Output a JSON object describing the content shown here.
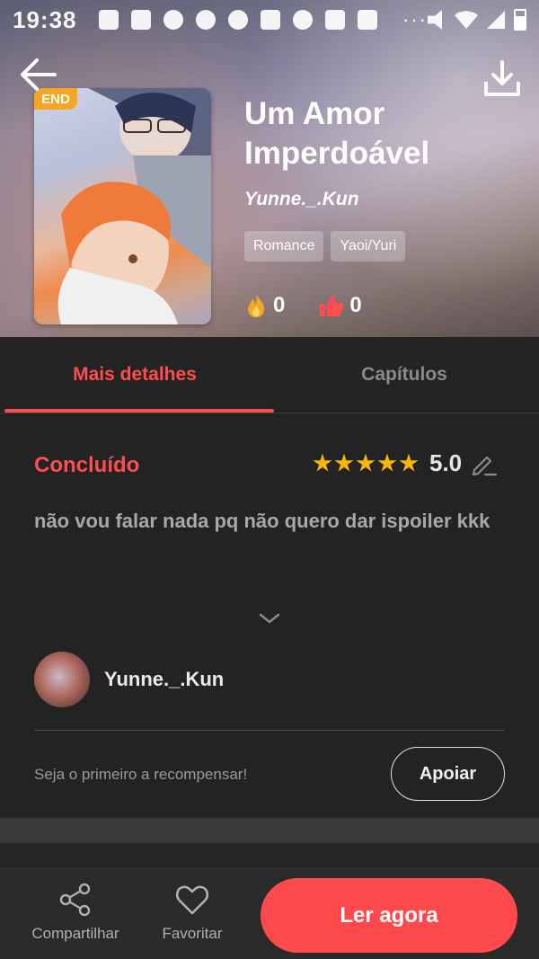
{
  "status_bar": {
    "time": "19:38",
    "dots": "···"
  },
  "header": {
    "back_icon": "arrow-left-icon",
    "download_icon": "download-icon",
    "badge": "END",
    "title": "Um Amor Imperdoável",
    "author": "Yunne._.Kun",
    "tags": [
      "Romance",
      "Yaoi/Yuri"
    ],
    "fire_count": "0",
    "like_count": "0"
  },
  "tabs": [
    {
      "label": "Mais detalhes",
      "active": true
    },
    {
      "label": "Capítulos",
      "active": false
    }
  ],
  "details": {
    "status": "Concluído",
    "rating": "5.0",
    "stars": 5,
    "description": "não vou falar nada pq não quero dar ispoiler kkk",
    "author_name": "Yunne._.Kun",
    "reward_text": "Seja o primeiro a recompensar!",
    "support_label": "Apoiar"
  },
  "bottom_bar": {
    "share_label": "Compartilhar",
    "favorite_label": "Favoritar",
    "read_label": "Ler agora"
  },
  "colors": {
    "accent": "#ff4d4f",
    "star": "#f5b70a",
    "badge": "#f5a623",
    "background": "#232323"
  }
}
